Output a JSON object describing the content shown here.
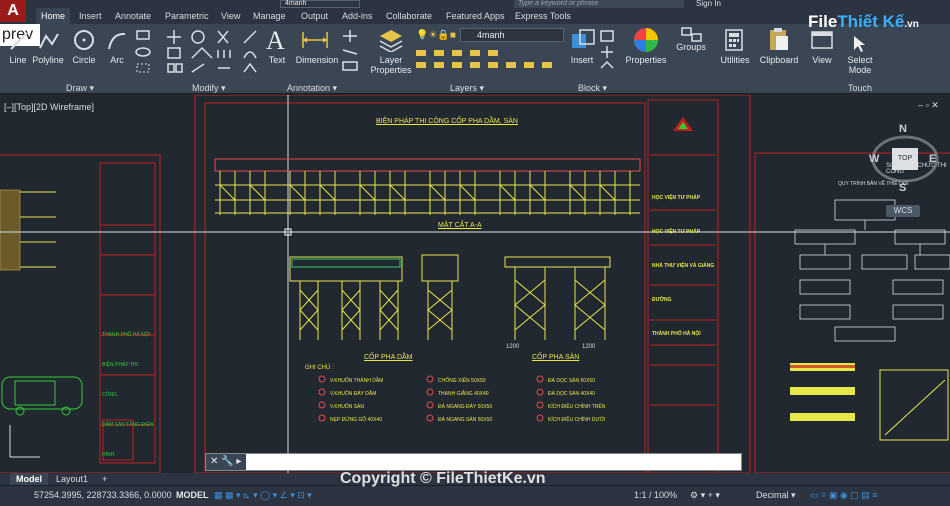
{
  "app": {
    "title_search_placeholder": "Type a keyword or phrase",
    "sign_in": "Sign In",
    "layer_title_field": "4manh",
    "app_button": "A",
    "prev_label": "prev"
  },
  "ribbon_tabs": [
    "Home",
    "Insert",
    "Annotate",
    "Parametric",
    "View",
    "Manage",
    "Output",
    "Add-ins",
    "Collaborate",
    "Featured Apps",
    "Express Tools"
  ],
  "ribbon": {
    "draw_buttons": [
      "Line",
      "Polyline",
      "Circle",
      "Arc"
    ],
    "text_button": "Text",
    "dimension_button": "Dimension",
    "layer_props_button_line1": "Layer",
    "layer_props_button_line2": "Properties",
    "layer_current": "4manh",
    "insert_button": "Insert",
    "properties_button": "Properties",
    "groups_button": "Groups",
    "utilities_button": "Utilities",
    "clipboard_button": "Clipboard",
    "view_button": "View",
    "select_mode_line1": "Select",
    "select_mode_line2": "Mode",
    "touch_label": "Touch",
    "panels": [
      "Draw",
      "Modify",
      "Annotation",
      "Layers",
      "Block"
    ]
  },
  "viewport": {
    "label": "[–][Top][2D Wireframe]",
    "viewcube_top": "TOP",
    "compass": {
      "n": "N",
      "s": "S",
      "e": "E",
      "w": "W"
    },
    "wcs": "WCS"
  },
  "drawing": {
    "main_title": "BIỆN PHÁP THI CÔNG CỐP PHA DẦM, SÀN",
    "section_title": "MẶT CẮT A-A",
    "beam_label": "CỐP PHA DẦM",
    "slab_label": "CỐP PHA SÀN",
    "notes_title": "GHI CHÚ :",
    "notes_col1": [
      "V.KHUÔN THÀNH DẦM",
      "V.KHUÔN ĐÁY DẦM",
      "V.KHUÔN SÀN",
      "NẸP ĐỨNG GỖ 40X40"
    ],
    "notes_col2": [
      "CHỐNG XIÊN 50X50",
      "THANH GIẰNG 40X40",
      "ĐÀ NGANG ĐÁY 50X50",
      "ĐÀ NGANG SÀN 50X50"
    ],
    "notes_col3": [
      "ĐÀ DỌC SÀN 50X50",
      "ĐÀ DỌC SÀN 40X40",
      "KÍCH ĐIỀU CHỈNH TRÊN",
      "KÍCH ĐIỀU CHỈNH DƯỚI"
    ],
    "dim_left": "1200",
    "dim_right": "1200",
    "title_block_texts": [
      "HỌC VIỆN TƯ PHÁP",
      "HỌC VIỆN TƯ PHÁP",
      "NHÀ THƯ VIỆN VÀ GIẢNG ĐƯỜNG",
      "THÀNH PHỐ HÀ NỘI"
    ],
    "left_block_texts": [
      "THÀNH PHỐ HÀ NỘI",
      "BIỆN PHÁP THI CÔNG",
      "DẦM SÀN TẦNG ĐIỂN HÌNH"
    ],
    "right_title": "SƠ ĐỒ TỔ CHỨC THI CÔNG",
    "right_chart_title": "QUY TRÌNH BẢN VẼ THIẾT KẾ"
  },
  "layout_tabs": [
    "Model",
    "Layout1",
    "+"
  ],
  "status": {
    "coords": "57254.3995, 228733.3366, 0.0000",
    "model": "MODEL",
    "scale": "1:1 / 100%",
    "units": "Decimal"
  },
  "watermark": "Copyright © FileThietKe.vn",
  "logo": {
    "prefix": "File",
    "suffix": "Thiết Kế",
    "domain": ".vn"
  }
}
